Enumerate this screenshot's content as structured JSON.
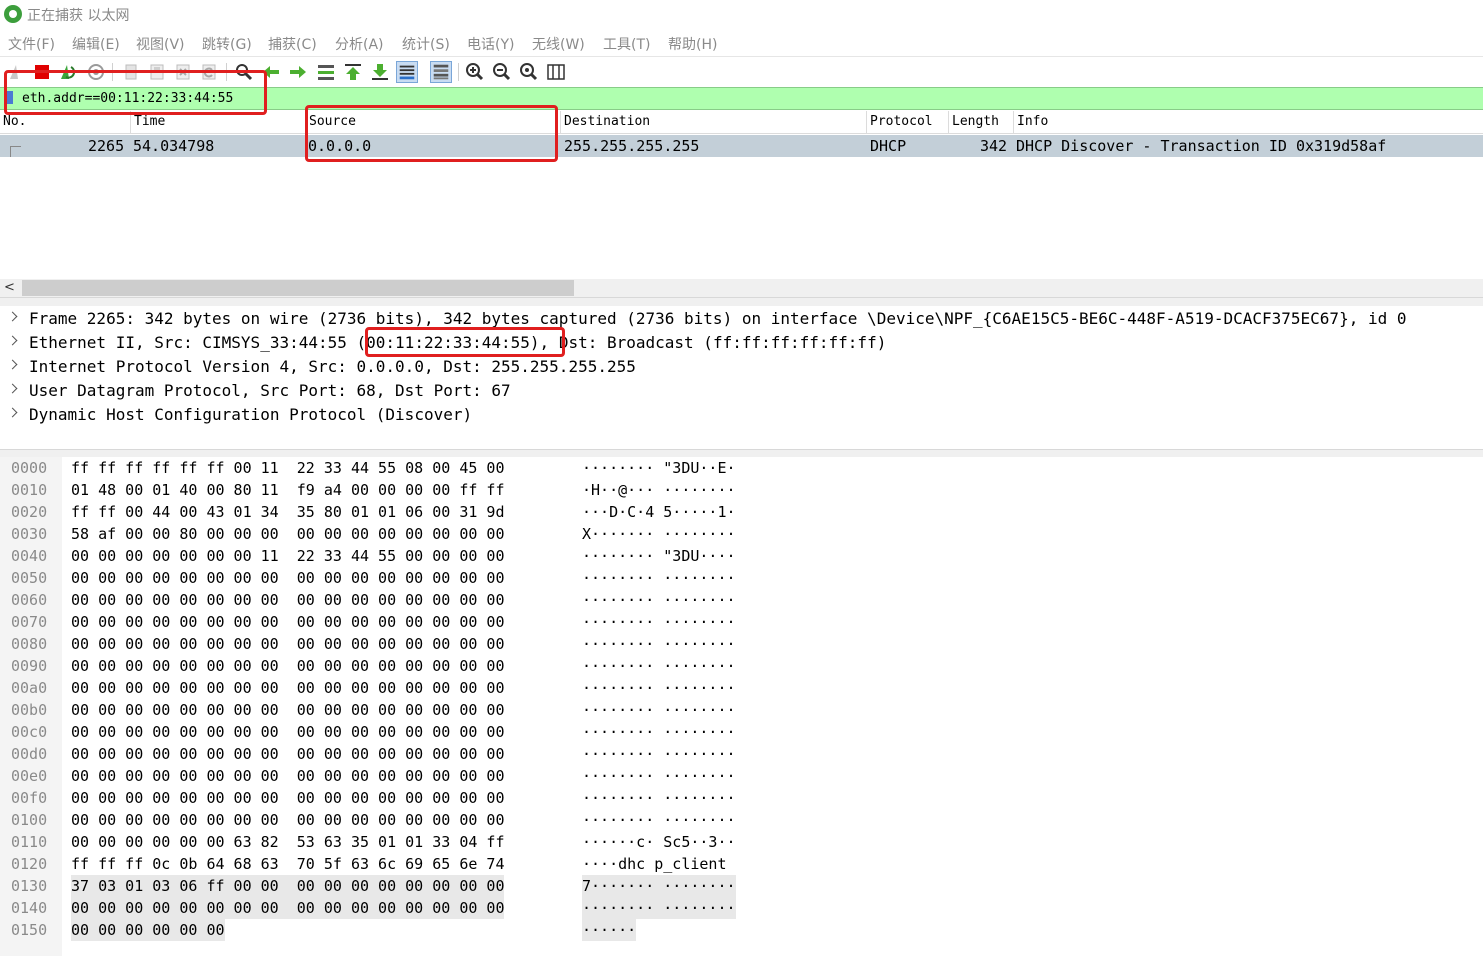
{
  "window": {
    "title": "正在捕获 以太网"
  },
  "menu": [
    "文件(F)",
    "编辑(E)",
    "视图(V)",
    "跳转(G)",
    "捕获(C)",
    "分析(A)",
    "统计(S)",
    "电话(Y)",
    "无线(W)",
    "工具(T)",
    "帮助(H)"
  ],
  "toolbar": {
    "icons": [
      "shark-fin-icon",
      "stop-capture-icon",
      "restart-capture-icon",
      "capture-options-icon",
      "open-file-icon",
      "save-file-icon",
      "close-file-icon",
      "reload-file-icon",
      "find-packet-icon",
      "go-back-icon",
      "go-forward-icon",
      "go-to-packet-icon",
      "go-first-icon",
      "go-last-icon",
      "auto-scroll-icon",
      "colorize-icon",
      "zoom-in-icon",
      "zoom-out-icon",
      "normal-size-icon",
      "resize-columns-icon"
    ]
  },
  "filter": {
    "value": "eth.addr==00:11:22:33:44:55"
  },
  "packet_list": {
    "columns": [
      "No.",
      "Time",
      "Source",
      "Destination",
      "Protocol",
      "Length",
      "Info"
    ],
    "rows": [
      {
        "no": "2265",
        "time": "54.034798",
        "source": "0.0.0.0",
        "destination": "255.255.255.255",
        "protocol": "DHCP",
        "length": "342",
        "info": "DHCP Discover - Transaction ID 0x319d58af"
      }
    ]
  },
  "details": [
    {
      "text": "Frame 2265: 342 bytes on wire (2736 bits), 342 bytes captured (2736 bits) on interface \\Device\\NPF_{C6AE15C5-BE6C-448F-A519-DCACF375EC67}, id 0"
    },
    {
      "text_pre": "Ethernet II, Src: CIMSYS_33:44:55 ",
      "text_mac": "(00:11:22:33:44:55)",
      "text_post": ", Dst: Broadcast (ff:ff:ff:ff:ff:ff)"
    },
    {
      "text": "Internet Protocol Version 4, Src: 0.0.0.0, Dst: 255.255.255.255"
    },
    {
      "text": "User Datagram Protocol, Src Port: 68, Dst Port: 67"
    },
    {
      "text": "Dynamic Host Configuration Protocol (Discover)"
    }
  ],
  "hex": [
    {
      "offset": "0000",
      "bytes": "ff ff ff ff ff ff 00 11  22 33 44 55 08 00 45 00",
      "ascii": "········ \"3DU··E·"
    },
    {
      "offset": "0010",
      "bytes": "01 48 00 01 40 00 80 11  f9 a4 00 00 00 00 ff ff",
      "ascii": "·H··@··· ········"
    },
    {
      "offset": "0020",
      "bytes": "ff ff 00 44 00 43 01 34  35 80 01 01 06 00 31 9d",
      "ascii": "···D·C·4 5·····1·"
    },
    {
      "offset": "0030",
      "bytes": "58 af 00 00 80 00 00 00  00 00 00 00 00 00 00 00",
      "ascii": "X······· ········"
    },
    {
      "offset": "0040",
      "bytes": "00 00 00 00 00 00 00 11  22 33 44 55 00 00 00 00",
      "ascii": "········ \"3DU····"
    },
    {
      "offset": "0050",
      "bytes": "00 00 00 00 00 00 00 00  00 00 00 00 00 00 00 00",
      "ascii": "········ ········"
    },
    {
      "offset": "0060",
      "bytes": "00 00 00 00 00 00 00 00  00 00 00 00 00 00 00 00",
      "ascii": "········ ········"
    },
    {
      "offset": "0070",
      "bytes": "00 00 00 00 00 00 00 00  00 00 00 00 00 00 00 00",
      "ascii": "········ ········"
    },
    {
      "offset": "0080",
      "bytes": "00 00 00 00 00 00 00 00  00 00 00 00 00 00 00 00",
      "ascii": "········ ········"
    },
    {
      "offset": "0090",
      "bytes": "00 00 00 00 00 00 00 00  00 00 00 00 00 00 00 00",
      "ascii": "········ ········"
    },
    {
      "offset": "00a0",
      "bytes": "00 00 00 00 00 00 00 00  00 00 00 00 00 00 00 00",
      "ascii": "········ ········"
    },
    {
      "offset": "00b0",
      "bytes": "00 00 00 00 00 00 00 00  00 00 00 00 00 00 00 00",
      "ascii": "········ ········"
    },
    {
      "offset": "00c0",
      "bytes": "00 00 00 00 00 00 00 00  00 00 00 00 00 00 00 00",
      "ascii": "········ ········"
    },
    {
      "offset": "00d0",
      "bytes": "00 00 00 00 00 00 00 00  00 00 00 00 00 00 00 00",
      "ascii": "········ ········"
    },
    {
      "offset": "00e0",
      "bytes": "00 00 00 00 00 00 00 00  00 00 00 00 00 00 00 00",
      "ascii": "········ ········"
    },
    {
      "offset": "00f0",
      "bytes": "00 00 00 00 00 00 00 00  00 00 00 00 00 00 00 00",
      "ascii": "········ ········"
    },
    {
      "offset": "0100",
      "bytes": "00 00 00 00 00 00 00 00  00 00 00 00 00 00 00 00",
      "ascii": "········ ········"
    },
    {
      "offset": "0110",
      "bytes": "00 00 00 00 00 00 63 82  53 63 35 01 01 33 04 ff",
      "ascii": "······c· Sc5··3··"
    },
    {
      "offset": "0120",
      "bytes": "ff ff ff 0c 0b 64 68 63  70 5f 63 6c 69 65 6e 74",
      "ascii": "····dhc p_client"
    },
    {
      "offset": "0130",
      "bytes": "37 03 01 03 06 ff 00 00  00 00 00 00 00 00 00 00",
      "ascii": "7······· ········",
      "hl": true
    },
    {
      "offset": "0140",
      "bytes": "00 00 00 00 00 00 00 00  00 00 00 00 00 00 00 00",
      "ascii": "········ ········",
      "hl": true
    },
    {
      "offset": "0150",
      "bytes": "00 00 00 00 00 00",
      "ascii": "······",
      "hl": true
    }
  ],
  "colors": {
    "filter_bg": "#afffaf",
    "selected_row": "#c3cfd8",
    "annotation": "#e01f1f"
  }
}
